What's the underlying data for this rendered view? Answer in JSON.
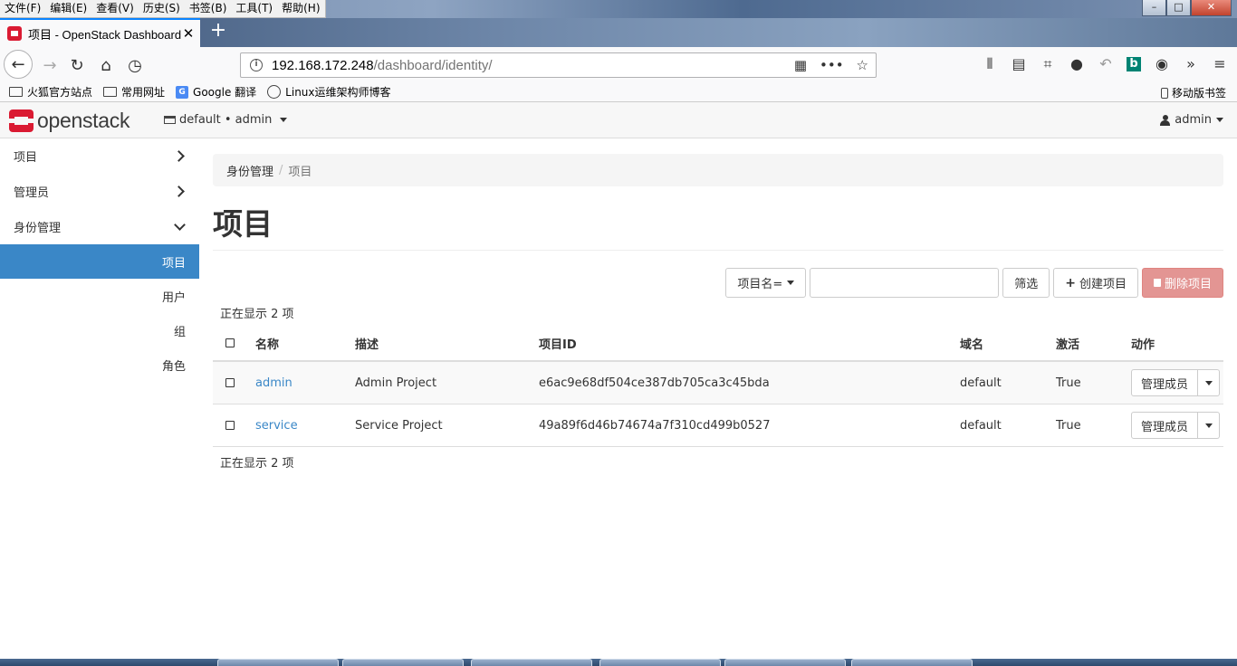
{
  "browser": {
    "menu": [
      "文件(F)",
      "编辑(E)",
      "查看(V)",
      "历史(S)",
      "书签(B)",
      "工具(T)",
      "帮助(H)"
    ],
    "tab_title": "项目 - OpenStack Dashboard",
    "url_host": "192.168.172.248",
    "url_path": "/dashboard/identity/",
    "bookmarks": [
      "火狐官方站点",
      "常用网址",
      "Google 翻译",
      "Linux运维架构师博客"
    ],
    "mobile_bookmarks": "移动版书签"
  },
  "header": {
    "logo": "openstack",
    "context": "default • admin",
    "user": "admin"
  },
  "sidebar": {
    "items": [
      {
        "label": "项目"
      },
      {
        "label": "管理员"
      },
      {
        "label": "身份管理"
      }
    ],
    "subitems": [
      {
        "label": "项目"
      },
      {
        "label": "用户"
      },
      {
        "label": "组"
      },
      {
        "label": "角色"
      }
    ]
  },
  "main": {
    "breadcrumb": [
      "身份管理",
      "项目"
    ],
    "title": "项目",
    "filter_select": "项目名=",
    "filter_button": "筛选",
    "create_button": "创建项目",
    "delete_button": "删除项目",
    "count_text": "正在显示 2 项",
    "table": {
      "headers": [
        "名称",
        "描述",
        "项目ID",
        "域名",
        "激活",
        "动作"
      ],
      "rows": [
        {
          "name": "admin",
          "description": "Admin Project",
          "id": "e6ac9e68df504ce387db705ca3c45bda",
          "domain": "default",
          "enabled": "True",
          "action": "管理成员"
        },
        {
          "name": "service",
          "description": "Service Project",
          "id": "49a89f6d46b74674a7f310cd499b0527",
          "domain": "default",
          "enabled": "True",
          "action": "管理成员"
        }
      ]
    }
  },
  "colors": {
    "accent": "#3a87c7",
    "danger": "#e39593",
    "brand": "#da1a32"
  }
}
